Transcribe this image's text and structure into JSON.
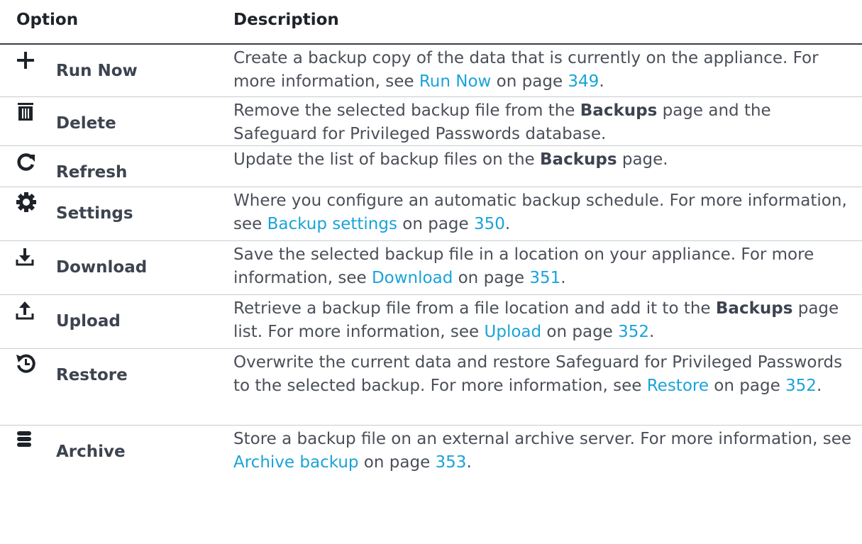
{
  "header": {
    "option": "Option",
    "description": "Description"
  },
  "rows": [
    {
      "label": "Run Now",
      "icon": "plus-icon",
      "parts": [
        {
          "t": "Create a backup copy of the data that is currently on the appliance. For more information, see "
        },
        {
          "t": "Run Now",
          "link": true
        },
        {
          "t": " on page "
        },
        {
          "t": "349",
          "link": true
        },
        {
          "t": "."
        }
      ]
    },
    {
      "label": "Delete",
      "icon": "trash-icon",
      "parts": [
        {
          "t": "Remove the selected backup file from the "
        },
        {
          "t": "Backups",
          "bold": true
        },
        {
          "t": " page and the Safeguard for Privileged Passwords database."
        }
      ]
    },
    {
      "label": "Refresh",
      "icon": "refresh-icon",
      "parts": [
        {
          "t": "Update the list of backup files on the "
        },
        {
          "t": "Backups",
          "bold": true
        },
        {
          "t": " page."
        }
      ]
    },
    {
      "label": "Settings",
      "icon": "gear-icon",
      "parts": [
        {
          "t": "Where you configure an automatic backup schedule. For more information, see "
        },
        {
          "t": "Backup settings",
          "link": true
        },
        {
          "t": " on page "
        },
        {
          "t": "350",
          "link": true
        },
        {
          "t": "."
        }
      ]
    },
    {
      "label": "Download",
      "icon": "download-icon",
      "parts": [
        {
          "t": "Save the selected backup file in a location on your appliance. For more information, see "
        },
        {
          "t": "Download",
          "link": true
        },
        {
          "t": " on page "
        },
        {
          "t": "351",
          "link": true
        },
        {
          "t": "."
        }
      ]
    },
    {
      "label": "Upload",
      "icon": "upload-icon",
      "parts": [
        {
          "t": "Retrieve a backup file from a file location and add it to the "
        },
        {
          "t": "Backups",
          "bold": true
        },
        {
          "t": " page list. For more information, see "
        },
        {
          "t": "Upload",
          "link": true
        },
        {
          "t": " on page "
        },
        {
          "t": "352",
          "link": true
        },
        {
          "t": "."
        }
      ]
    },
    {
      "label": "Restore",
      "icon": "restore-icon",
      "parts": [
        {
          "t": "Overwrite the current data and restore Safeguard for Privileged Passwords to the selected backup. For more information, see "
        },
        {
          "t": "Restore",
          "link": true
        },
        {
          "t": " on page "
        },
        {
          "t": "352",
          "link": true
        },
        {
          "t": "."
        }
      ]
    },
    {
      "label": "Archive",
      "icon": "database-icon",
      "parts": [
        {
          "t": "Store a backup file on an external archive server. For more information, see "
        },
        {
          "t": "Archive backup",
          "link": true
        },
        {
          "t": " on page "
        },
        {
          "t": "353",
          "link": true
        },
        {
          "t": "."
        }
      ]
    }
  ]
}
